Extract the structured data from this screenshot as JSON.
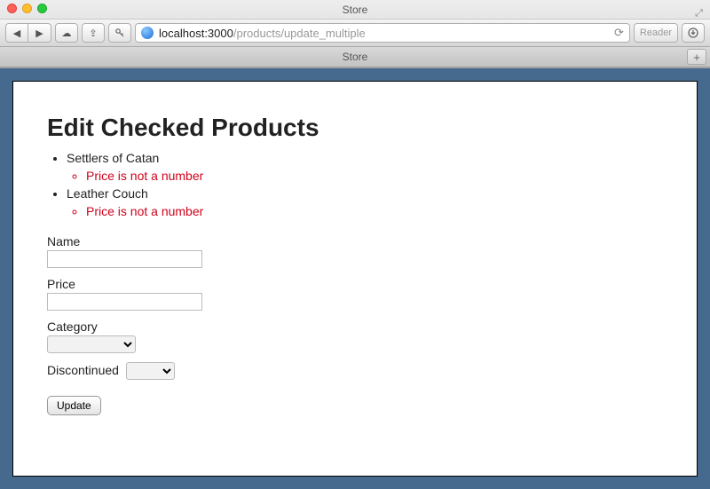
{
  "window": {
    "title": "Store",
    "tab_title": "Store"
  },
  "toolbar": {
    "reader_label": "Reader"
  },
  "url": {
    "host": "localhost",
    "port": ":3000",
    "path": "/products/update_multiple"
  },
  "page": {
    "heading": "Edit Checked Products",
    "errors": [
      {
        "product": "Settlers of Catan",
        "messages": [
          "Price is not a number"
        ]
      },
      {
        "product": "Leather Couch",
        "messages": [
          "Price is not a number"
        ]
      }
    ],
    "form": {
      "name_label": "Name",
      "name_value": "",
      "price_label": "Price",
      "price_value": "",
      "category_label": "Category",
      "category_value": "",
      "discontinued_label": "Discontinued",
      "discontinued_value": "",
      "submit_label": "Update"
    }
  }
}
